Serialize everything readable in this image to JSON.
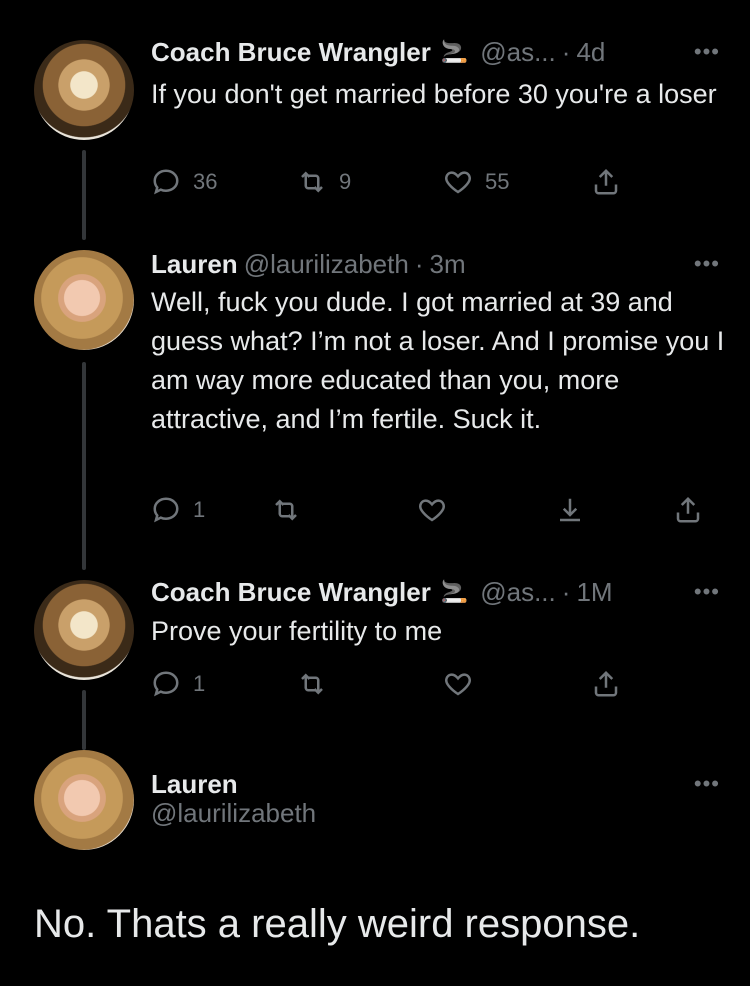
{
  "tweets": [
    {
      "name": "Coach Bruce Wrangler",
      "emoji": "🚬",
      "handle": "@as...",
      "time": "4d",
      "text": "If you don't get married before 30 you're a loser",
      "replies": "36",
      "retweets": "9",
      "likes": "55"
    },
    {
      "name": "Lauren",
      "handle": "@laurilizabeth",
      "time": "3m",
      "text": "Well, fuck you dude. I got married at 39 and guess what? I’m not a loser. And I promise you I am way more educated than you, more attractive, and I’m fertile. Suck it.",
      "replies": "1"
    },
    {
      "name": "Coach Bruce Wrangler",
      "emoji": "🚬",
      "handle": "@as...",
      "time": "1M",
      "text": "Prove your fertility to me",
      "replies": "1"
    },
    {
      "name": "Lauren",
      "handle": "@laurilizabeth",
      "text": "No. Thats a really weird response."
    }
  ],
  "ui": {
    "dot": "·",
    "more": "•••"
  },
  "icons": {
    "reply": "reply-icon",
    "retweet": "retweet-icon",
    "like": "heart-icon",
    "share": "share-icon",
    "download": "download-icon"
  }
}
